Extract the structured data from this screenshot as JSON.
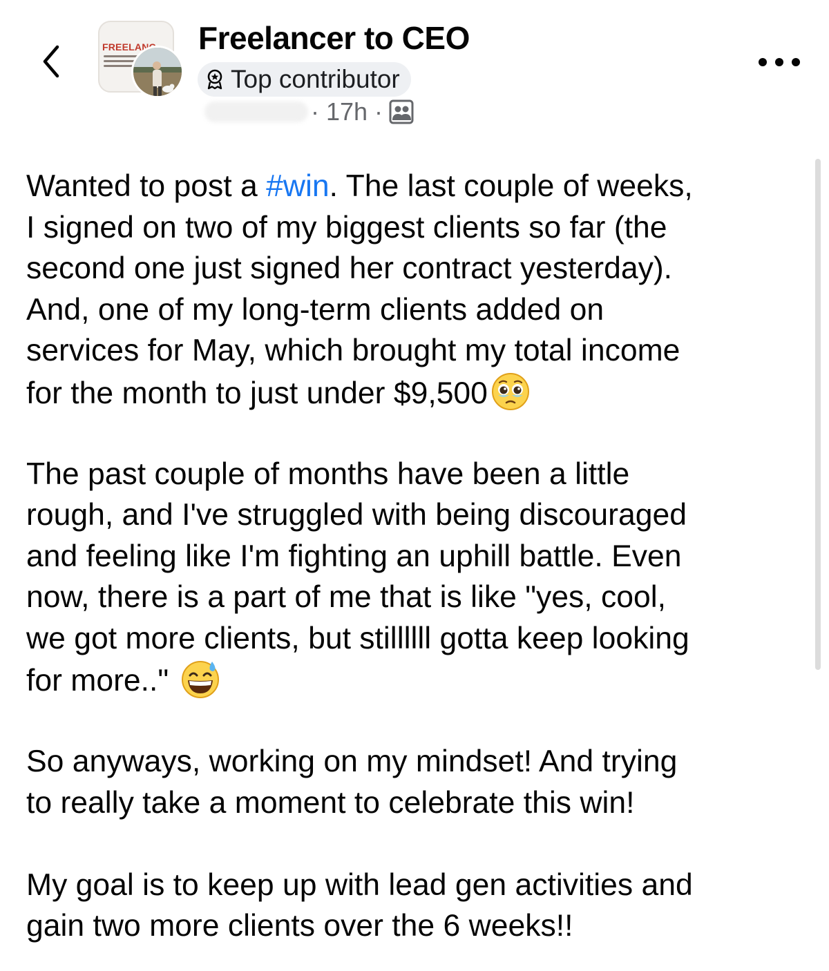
{
  "header": {
    "group_name": "Freelancer to CEO",
    "group_avatar_logo_text": "FREELANC",
    "badge_label": "Top contributor",
    "meta_time": "· 17h ·"
  },
  "icons": {
    "back": "chevron-left-icon",
    "badge": "award-icon",
    "audience": "group-members-icon",
    "more": "more-horizontal-icon",
    "emoji_1": "face-holding-back-tears-emoji",
    "emoji_2": "grinning-face-with-sweat-emoji"
  },
  "colors": {
    "hashtag": "#1877f2",
    "text": "#050505",
    "meta": "#65676b",
    "badge_bg": "#eef0f3"
  },
  "post": {
    "p1": {
      "l1_before": "Wanted to post a ",
      "l1_hashtag": "#win",
      "l1_after": ". The last couple of weeks,",
      "l2": "I signed on two of my biggest clients so far (the",
      "l3": "second one just signed her contract yesterday).",
      "l4": "And, one of my long-term clients added on",
      "l5": "services for May, which brought my total income",
      "l6": "for the month to just under $9,500"
    },
    "p2": {
      "l1": "The past couple of months have been a little",
      "l2": "rough, and I've struggled with being discouraged",
      "l3": "and feeling like I'm fighting an uphill battle. Even",
      "l4": "now, there is a part of me that is like \"yes, cool,",
      "l5": "we got more clients, but stillllll gotta keep looking",
      "l6": "for more..\""
    },
    "p3": {
      "l1": "So anyways, working on my mindset! And trying",
      "l2": "to really take a moment to celebrate this win!"
    },
    "p4": {
      "l1": "My goal is to keep up with lead gen activities and",
      "l2": "gain two more clients over the 6 weeks!!"
    }
  }
}
